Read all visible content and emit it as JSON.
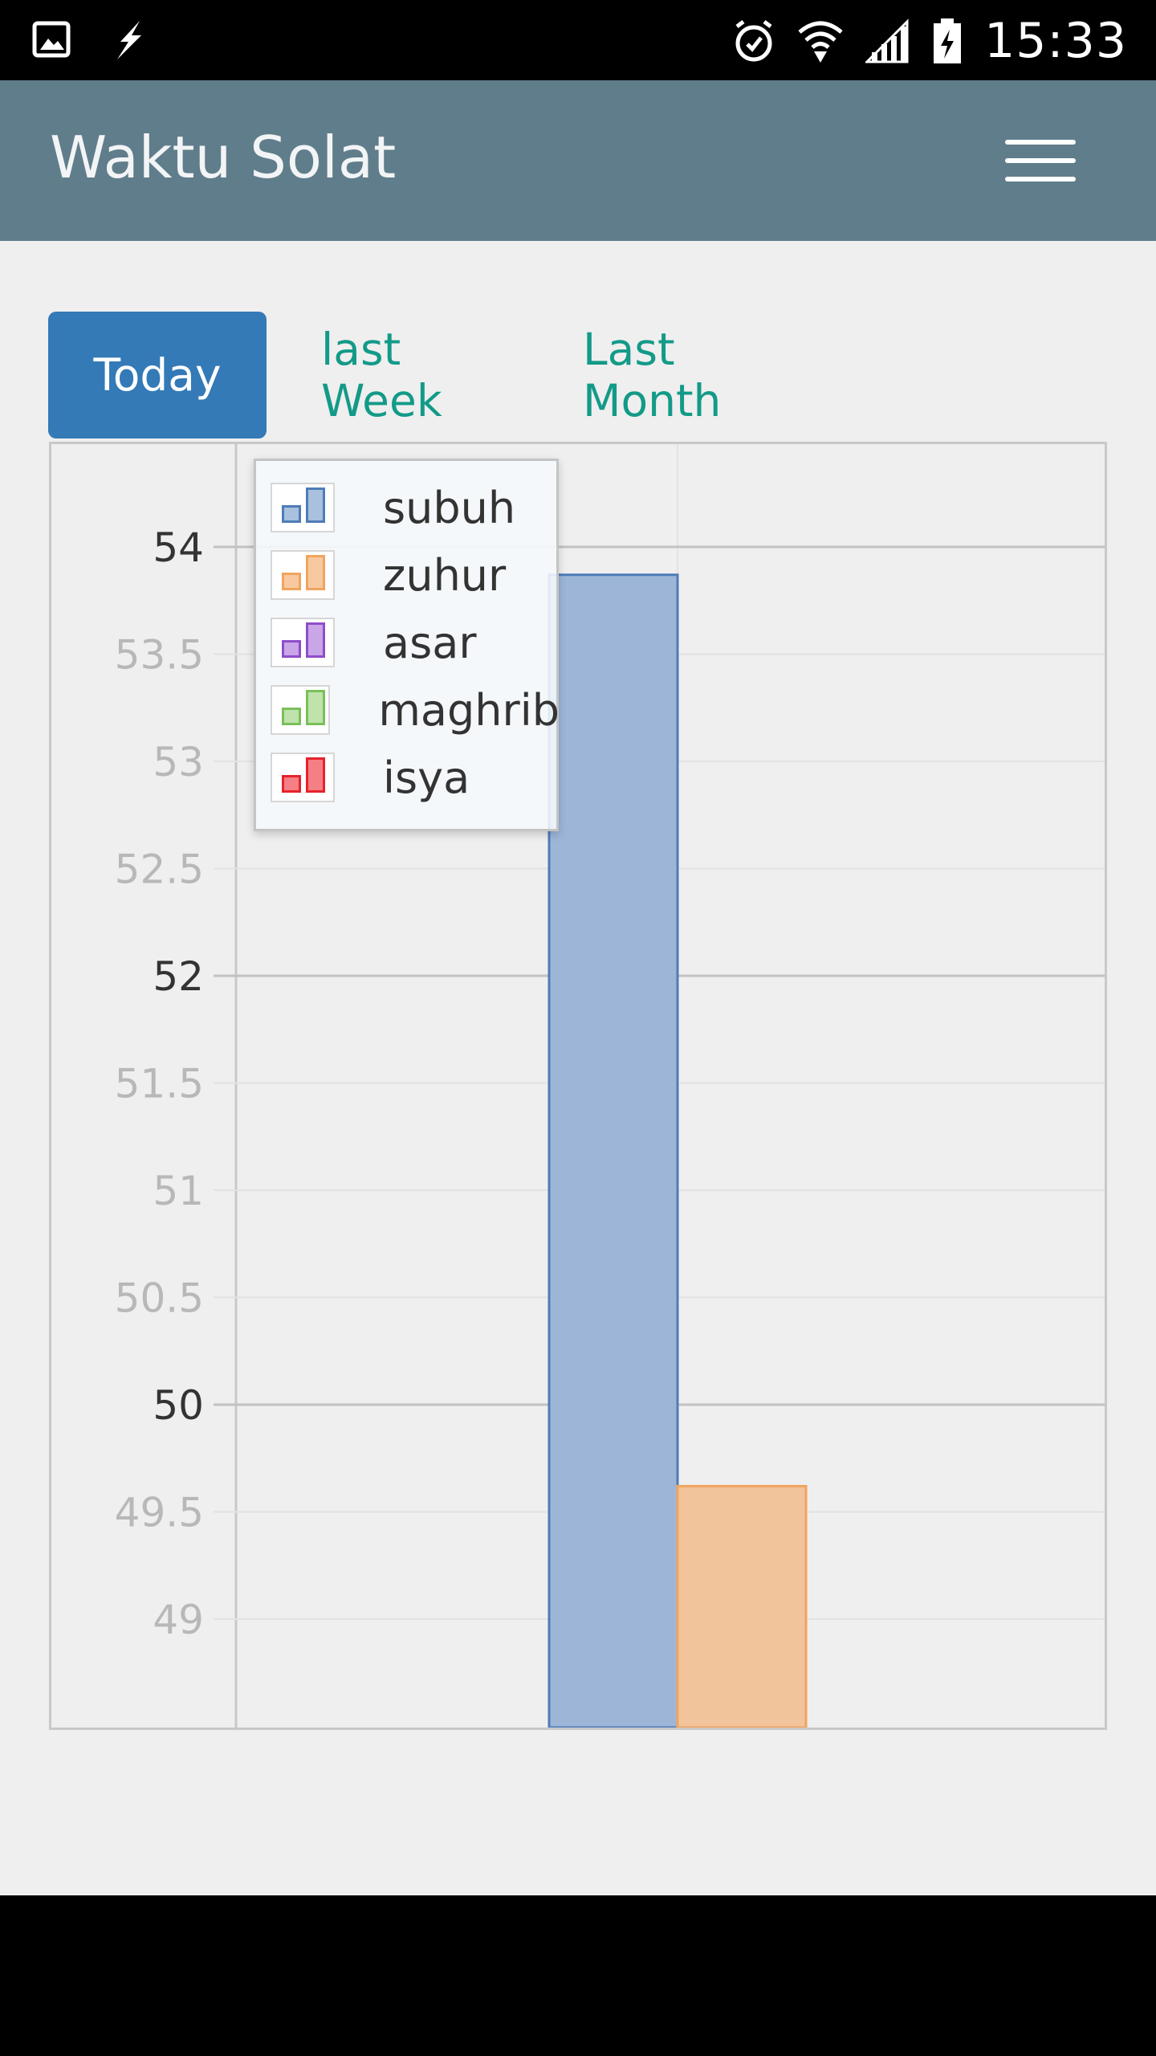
{
  "status_bar": {
    "time": "15:33",
    "icons": [
      "gallery-icon",
      "flash-icon",
      "alarm-icon",
      "wifi-icon",
      "signal-icon",
      "battery-charging-icon"
    ]
  },
  "app_bar": {
    "title": "Waktu Solat",
    "menu_icon": "hamburger-menu-icon"
  },
  "tabs": [
    {
      "label": "Today",
      "active": true
    },
    {
      "label": "last Week",
      "active": false
    },
    {
      "label": "Last Month",
      "active": false
    }
  ],
  "legend": [
    {
      "label": "subuh",
      "color": "#4f7cb8",
      "fill": "#a9c0de"
    },
    {
      "label": "zuhur",
      "color": "#f0a45f",
      "fill": "#f8c9a0"
    },
    {
      "label": "asar",
      "color": "#8e4dc9",
      "fill": "#c9a6e8"
    },
    {
      "label": "maghrib",
      "color": "#7ac05a",
      "fill": "#bfe3ab"
    },
    {
      "label": "isya",
      "color": "#e6232b",
      "fill": "#f47f85"
    }
  ],
  "chart_data": {
    "type": "bar",
    "y_ticks": [
      "54",
      "53.5",
      "53",
      "52.5",
      "52",
      "51.5",
      "51",
      "50.5",
      "50",
      "49.5",
      "49"
    ],
    "ylim": [
      48.5,
      54.5
    ],
    "series": [
      {
        "name": "subuh",
        "values": [
          53.87
        ],
        "color": "#4f7cb8",
        "fill": "#9db6d8"
      },
      {
        "name": "zuhur",
        "values": [
          49.62
        ],
        "color": "#f0a45f",
        "fill": "#f2c49b"
      }
    ]
  }
}
